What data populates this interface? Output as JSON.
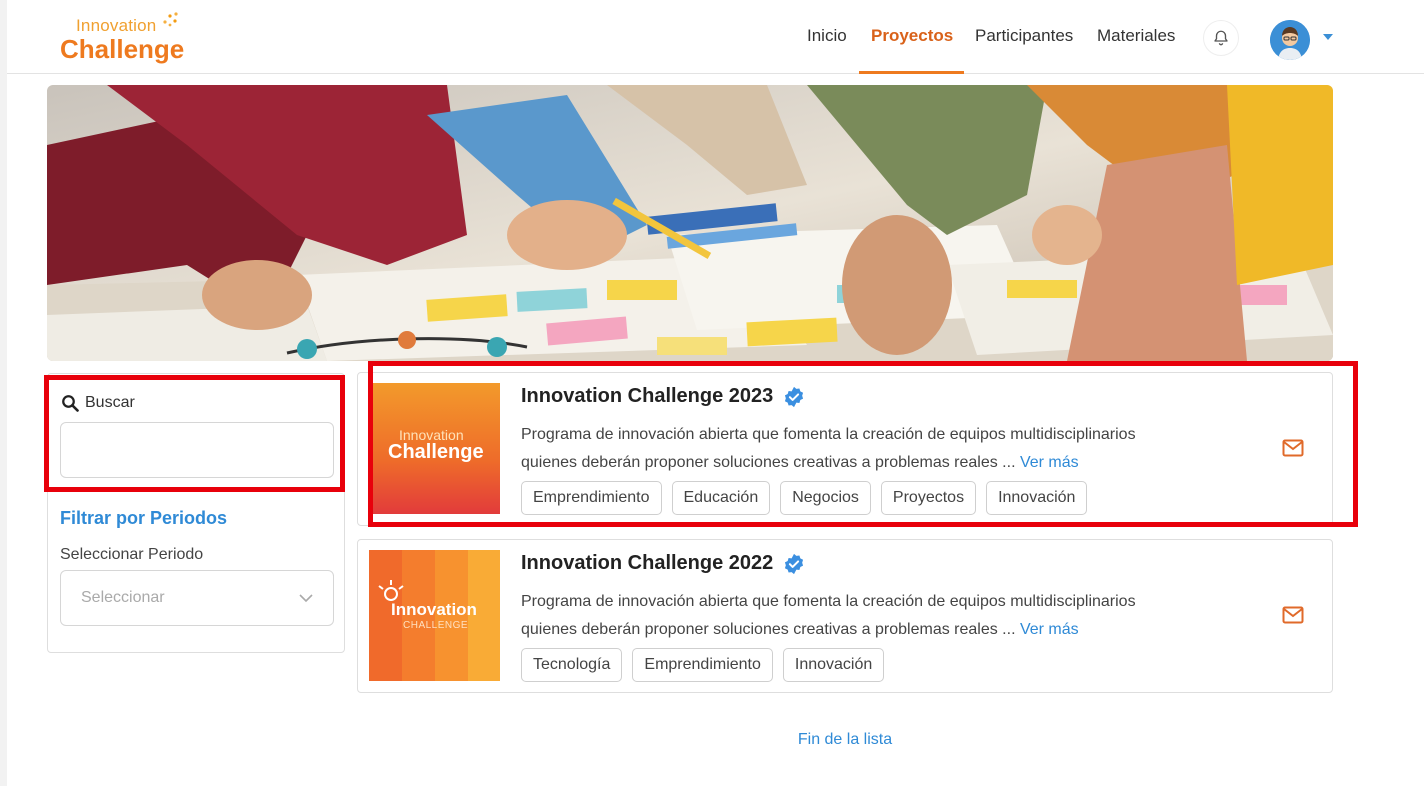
{
  "header": {
    "logo_line1": "Innovation",
    "logo_line2": "Challenge",
    "nav": [
      {
        "label": "Inicio",
        "active": false
      },
      {
        "label": "Proyectos",
        "active": true
      },
      {
        "label": "Participantes",
        "active": false
      },
      {
        "label": "Materiales",
        "active": false
      }
    ]
  },
  "sidebar": {
    "search_label": "Buscar",
    "search_value": "",
    "filter_title": "Filtrar por Periodos",
    "period_label": "Seleccionar Periodo",
    "period_placeholder": "Seleccionar"
  },
  "projects": [
    {
      "title": "Innovation Challenge 2023",
      "desc_line1": "Programa de innovación abierta que fomenta la creación de equipos multidisciplinarios",
      "desc_line2": "quienes deberán proponer soluciones creativas a problemas reales ...",
      "more_link": "Ver más",
      "thumb_line1": "Innovation",
      "thumb_line2": "Challenge",
      "tags": [
        "Emprendimiento",
        "Educación",
        "Negocios",
        "Proyectos",
        "Innovación"
      ]
    },
    {
      "title": "Innovation Challenge 2022",
      "desc_line1": "Programa de innovación abierta que fomenta la creación de equipos multidisciplinarios",
      "desc_line2": "quienes deberán proponer soluciones creativas a problemas reales ...",
      "more_link": "Ver más",
      "thumb_line1": "Innovation",
      "thumb_line2": "CHALLENGE",
      "tags": [
        "Tecnología",
        "Emprendimiento",
        "Innovación"
      ]
    }
  ],
  "footer": {
    "end_text": "Fin de la lista"
  },
  "colors": {
    "accent_orange": "#ee7a1f",
    "link_blue": "#2f8ad6",
    "highlight_red": "#e8000b"
  }
}
